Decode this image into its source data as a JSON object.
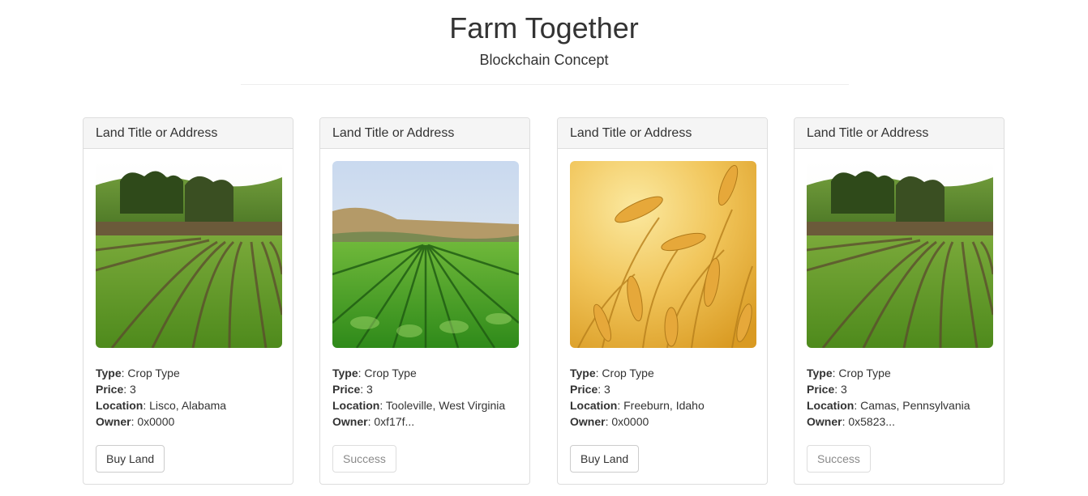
{
  "header": {
    "title": "Farm Together",
    "subtitle": "Blockchain Concept"
  },
  "labels": {
    "type": "Type",
    "price": "Price",
    "location": "Location",
    "owner": "Owner"
  },
  "cards": [
    {
      "heading": "Land Title or Address",
      "image": "green-crop-rows-hills",
      "type": "Crop Type",
      "price": "3",
      "location": "Lisco, Alabama",
      "owner": "0x0000",
      "button": "Buy Land",
      "button_disabled": false
    },
    {
      "heading": "Land Title or Address",
      "image": "lettuce-field-rows",
      "type": "Crop Type",
      "price": "3",
      "location": "Tooleville, West Virginia",
      "owner": "0xf17f...",
      "button": "Success",
      "button_disabled": true
    },
    {
      "heading": "Land Title or Address",
      "image": "golden-wheat",
      "type": "Crop Type",
      "price": "3",
      "location": "Freeburn, Idaho",
      "owner": "0x0000",
      "button": "Buy Land",
      "button_disabled": false
    },
    {
      "heading": "Land Title or Address",
      "image": "green-crop-rows-hills",
      "type": "Crop Type",
      "price": "3",
      "location": "Camas, Pennsylvania",
      "owner": "0x5823...",
      "button": "Success",
      "button_disabled": true
    }
  ]
}
